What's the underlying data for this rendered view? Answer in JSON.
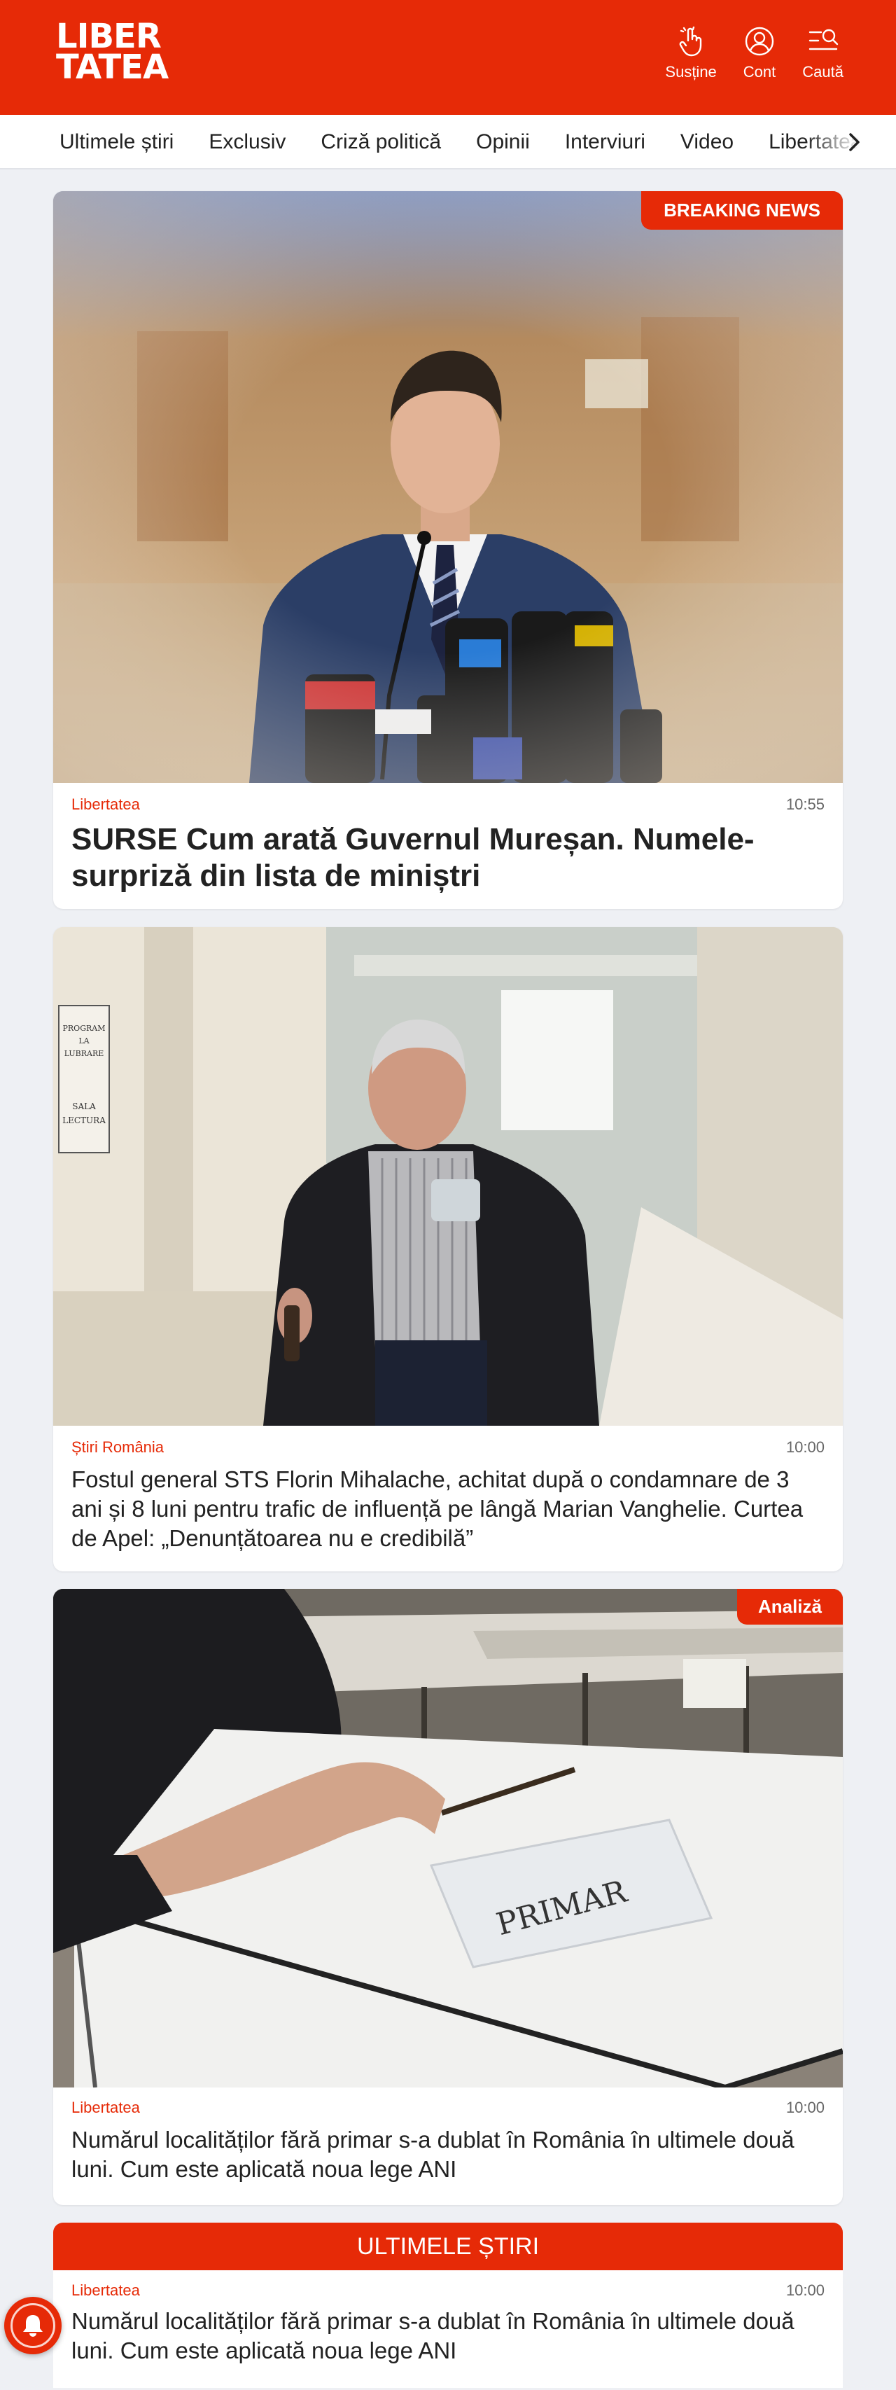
{
  "header": {
    "logo_line1": "LIBER",
    "logo_line2": "TATEA",
    "actions": [
      {
        "label": "Susține",
        "icon": "hand-icon"
      },
      {
        "label": "Cont",
        "icon": "account-icon"
      },
      {
        "label": "Caută",
        "icon": "search-menu-icon"
      }
    ]
  },
  "nav": {
    "items": [
      "Ultimele știri",
      "Exclusiv",
      "Criză politică",
      "Opinii",
      "Interviuri",
      "Video",
      "Libertatea"
    ]
  },
  "articles": [
    {
      "badge": "BREAKING NEWS",
      "category": "Libertatea",
      "time": "10:55",
      "title": "SURSE Cum arată Guvernul Mureșan. Numele-surpriză din lista de miniștri"
    },
    {
      "category": "Știri România",
      "time": "10:00",
      "title": "Fostul general STS Florin Mihalache, achitat după o condamnare de 3 ani și 8 luni pentru trafic de influență pe lângă Marian Vanghelie. Curtea de Apel: „Denunțătoarea nu e credibilă”",
      "photo_text": [
        "PROGRAM",
        "LA",
        "LUBRARE",
        "SALA",
        "LECTURA"
      ]
    },
    {
      "badge": "Analiză",
      "category": "Libertatea",
      "time": "10:00",
      "title": "Numărul localităților fără primar s-a dublat în România în ultimele două luni. Cum este aplicată noua lege ANI",
      "photo_text": "PRIMAR"
    }
  ],
  "latest": {
    "header": "ULTIMELE ȘTIRI",
    "item": {
      "category": "Libertatea",
      "time": "10:00",
      "title": "Numărul localităților fără primar s-a dublat în România în ultimele două luni. Cum este aplicată noua lege ANI"
    }
  },
  "colors": {
    "brand": "#e62a07",
    "background": "#eef0f4"
  }
}
